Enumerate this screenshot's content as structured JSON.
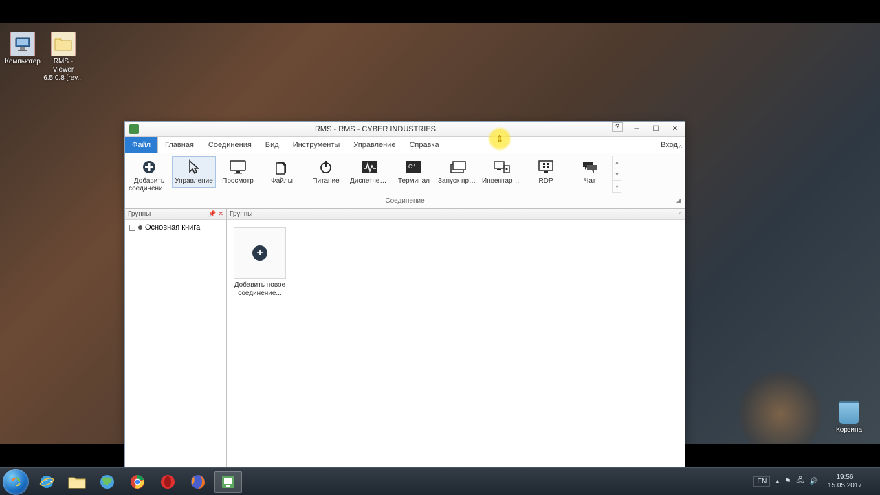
{
  "desktop": {
    "icons": [
      {
        "label": "Компьютер"
      },
      {
        "label": "RMS - Viewer 6.5.0.8 [rev..."
      }
    ],
    "recycle": "Корзина"
  },
  "window": {
    "title": "RMS - RMS - CYBER INDUSTRIES",
    "menu": {
      "file": "Файл",
      "tabs": [
        "Главная",
        "Соединения",
        "Вид",
        "Инструменты",
        "Управление",
        "Справка"
      ],
      "login": "Вход"
    },
    "ribbon": {
      "tools": [
        {
          "label": "Добавить соединение..."
        },
        {
          "label": "Управление"
        },
        {
          "label": "Просмотр"
        },
        {
          "label": "Файлы"
        },
        {
          "label": "Питание"
        },
        {
          "label": "Диспетчер ..."
        },
        {
          "label": "Терминал"
        },
        {
          "label": "Запуск про..."
        },
        {
          "label": "Инвентариз..."
        },
        {
          "label": "RDP"
        },
        {
          "label": "Чат"
        }
      ],
      "group_label": "Соединение"
    },
    "sidebar": {
      "header": "Группы",
      "root_item": "Основная книга"
    },
    "main": {
      "header": "Группы",
      "add_tile": "Добавить новое соединение..."
    }
  },
  "taskbar": {
    "lang": "EN",
    "time": "19:56",
    "date": "15.05.2017"
  }
}
